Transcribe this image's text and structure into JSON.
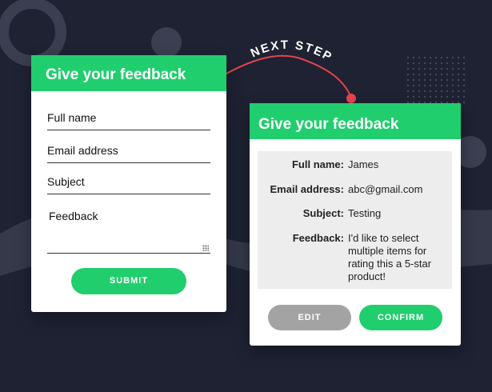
{
  "colors": {
    "background": "#1f2233",
    "accent": "#21ce6e",
    "edit_button": "#a3a3a3",
    "arrow": "#e8434f",
    "summary_bg": "#ededed"
  },
  "banner": {
    "label": "NEXT STEP"
  },
  "form": {
    "title": "Give your feedback",
    "full_name_placeholder": "Full name",
    "email_placeholder": "Email address",
    "subject_placeholder": "Subject",
    "feedback_placeholder": "Feedback",
    "submit_label": "SUBMIT"
  },
  "review": {
    "title": "Give your feedback",
    "rows": [
      {
        "label": "Full name:",
        "value": "James"
      },
      {
        "label": "Email address:",
        "value": "abc@gmail.com"
      },
      {
        "label": "Subject:",
        "value": "Testing"
      },
      {
        "label": "Feedback:",
        "value": "I'd like to select multiple items for rating this a 5-star product!"
      }
    ],
    "edit_label": "EDIT",
    "confirm_label": "CONFIRM"
  }
}
